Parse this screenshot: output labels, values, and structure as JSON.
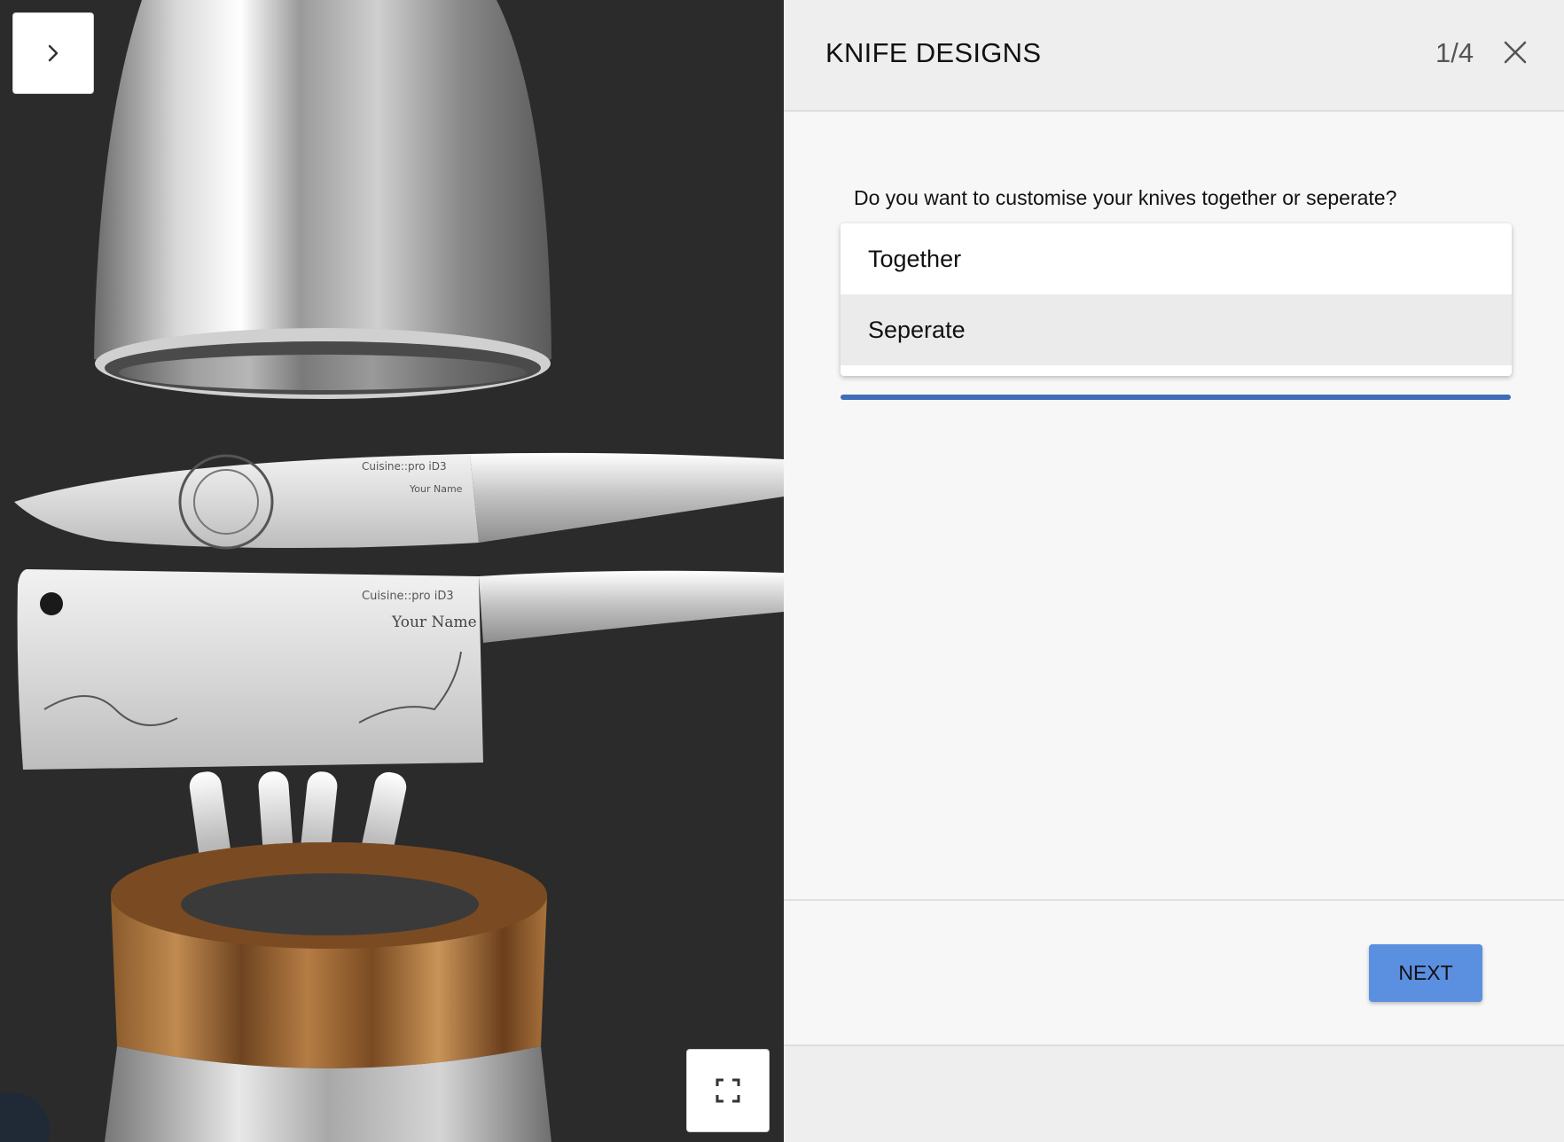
{
  "header": {
    "title": "KNIFE DESIGNS",
    "step": "1/4"
  },
  "question": "Do you want to customise your knives together or seperate?",
  "dropdown": {
    "options": [
      "Together",
      "Seperate"
    ],
    "highlighted_index": 1
  },
  "footer": {
    "next_label": "NEXT"
  },
  "viewer": {
    "engraving_brand": "Cuisine::pro iD3",
    "engraving_name": "Your Name"
  },
  "colors": {
    "accent": "#5b8fe0",
    "underline": "#3f6cb8",
    "viewer_background": "#2b2b2b"
  },
  "icons": {
    "toggle_panel": "chevron-right-icon",
    "close": "close-icon",
    "fullscreen": "fullscreen-icon"
  }
}
